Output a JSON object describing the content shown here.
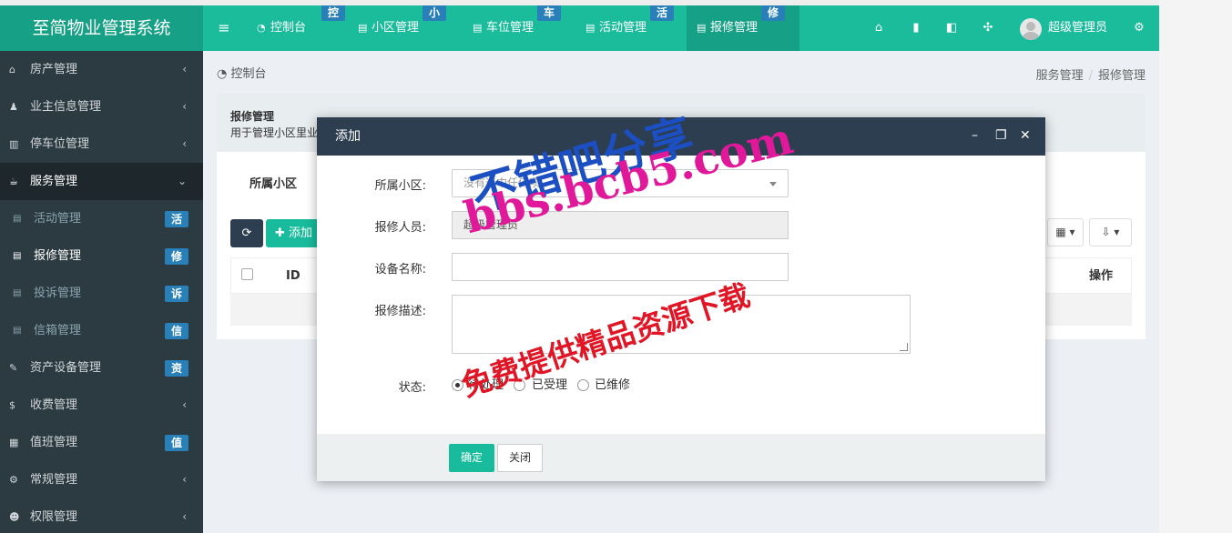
{
  "app": {
    "title": "至简物业管理系统"
  },
  "header": {
    "menu_icon": "bars-icon",
    "tabs": [
      {
        "label": "控制台",
        "badge": "控",
        "icon": "dashboard-icon"
      },
      {
        "label": "小区管理",
        "badge": "小",
        "icon": "list-icon"
      },
      {
        "label": "车位管理",
        "badge": "车",
        "icon": "list-icon"
      },
      {
        "label": "活动管理",
        "badge": "活",
        "icon": "list-icon"
      },
      {
        "label": "报修管理",
        "badge": "修",
        "icon": "list-icon"
      }
    ],
    "right_icons": [
      "home-icon",
      "trash-icon",
      "language-icon",
      "fullscreen-icon"
    ],
    "user_name": "超级管理员",
    "settings_icon": "cogs-icon"
  },
  "sidebar": {
    "items": [
      {
        "label": "房产管理",
        "icon": "home-icon",
        "caret": "‹"
      },
      {
        "label": "业主信息管理",
        "icon": "user-icon",
        "caret": "‹"
      },
      {
        "label": "停车位管理",
        "icon": "parking-icon",
        "caret": "‹"
      },
      {
        "label": "服务管理",
        "icon": "service-icon",
        "caret": "⌄"
      }
    ],
    "sub_items": [
      {
        "label": "活动管理",
        "badge": "活"
      },
      {
        "label": "报修管理",
        "badge": "修"
      },
      {
        "label": "投诉管理",
        "badge": "诉"
      },
      {
        "label": "信箱管理",
        "badge": "信"
      }
    ],
    "bottom_items": [
      {
        "label": "资产设备管理",
        "icon": "wrench-icon",
        "badge": "资"
      },
      {
        "label": "收费管理",
        "icon": "dollar-icon",
        "caret": "‹"
      },
      {
        "label": "值班管理",
        "icon": "calendar-icon",
        "badge": "值"
      },
      {
        "label": "常规管理",
        "icon": "cogs-icon",
        "caret": "‹"
      },
      {
        "label": "权限管理",
        "icon": "group-icon",
        "caret": "‹"
      }
    ]
  },
  "content": {
    "header_label": "控制台",
    "breadcrumb": [
      "服务管理",
      "报修管理"
    ],
    "panel_title": "报修管理",
    "panel_desc": "用于管理小区里业",
    "filter_label": "所属小区",
    "add_label": "添加",
    "table_columns": {
      "id": "ID",
      "op": "操作"
    }
  },
  "modal": {
    "title": "添加",
    "fields": {
      "community_label": "所属小区:",
      "community_placeholder": "没有选中任何项",
      "reporter_label": "报修人员:",
      "reporter_value": "超级管理员",
      "device_label": "设备名称:",
      "device_value": "",
      "desc_label": "报修描述:",
      "status_label": "状态:"
    },
    "status_options": [
      "待处理",
      "已受理",
      "已维修"
    ],
    "status_selected": "待处理",
    "ok_label": "确定",
    "close_label": "关闭"
  },
  "watermark": {
    "line1": "不错吧分享",
    "line2": "bbs.bcb5.com",
    "line3": "免费提供精品资源下载"
  },
  "colors": {
    "accent": "#1abc9c",
    "accent_dark": "#16a085",
    "badge": "#2980b9",
    "sidebar": "#2c3b41",
    "modal_header": "#2c3e50"
  }
}
